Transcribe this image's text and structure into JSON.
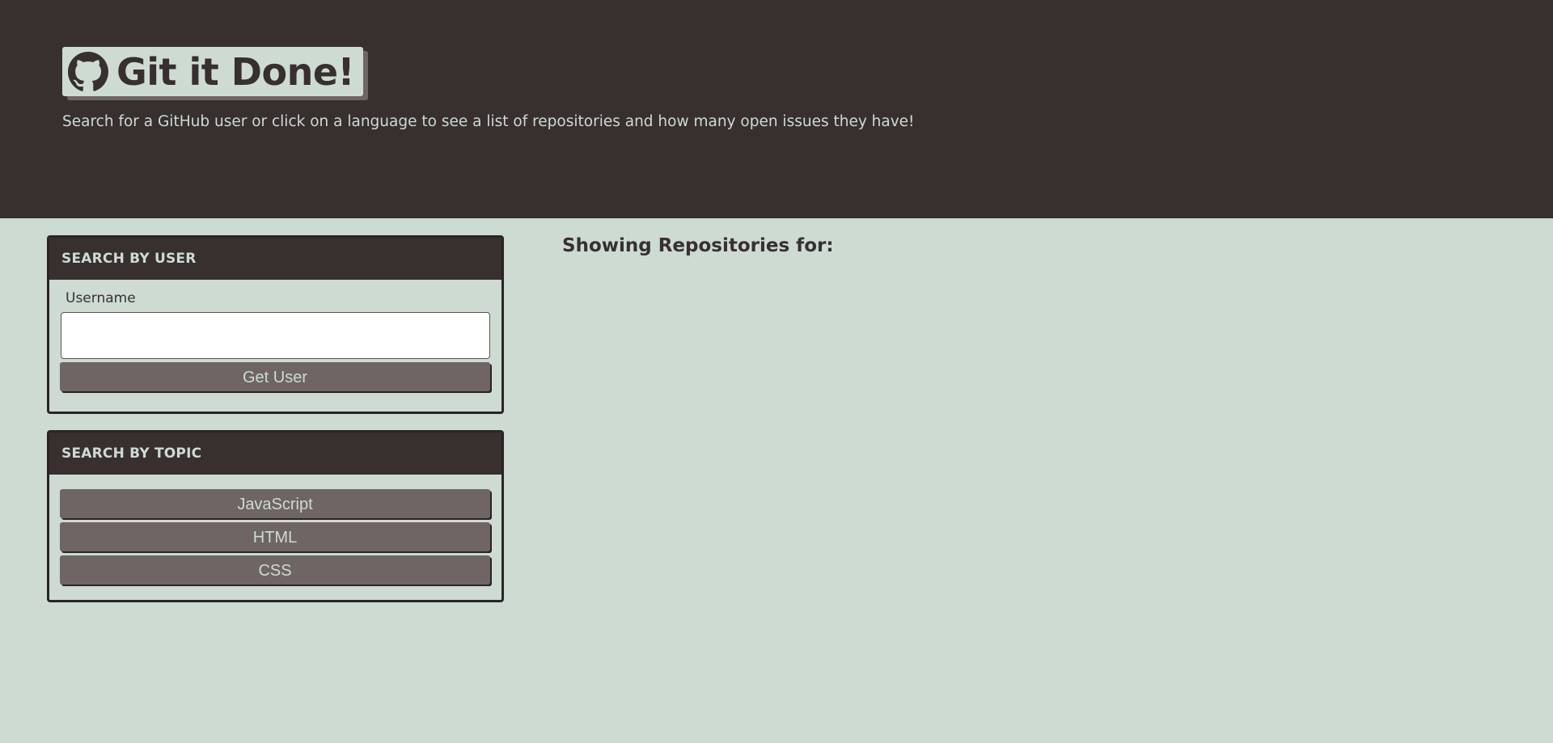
{
  "header": {
    "title": "Git it Done!",
    "subtitle": "Search for a GitHub user or click on a language to see a list of repositories and how many open issues they have!",
    "logo_icon": "github-icon"
  },
  "user_search": {
    "heading": "SEARCH BY USER",
    "username_label": "Username",
    "username_value": "",
    "username_placeholder": "",
    "submit_label": "Get User"
  },
  "topic_search": {
    "heading": "SEARCH BY TOPIC",
    "topics": [
      {
        "label": "JavaScript"
      },
      {
        "label": "HTML"
      },
      {
        "label": "CSS"
      }
    ]
  },
  "results": {
    "heading": "Showing Repositories for:"
  },
  "colors": {
    "dark": "#382f2f",
    "light": "#cddbd3",
    "button": "#6e6564"
  }
}
